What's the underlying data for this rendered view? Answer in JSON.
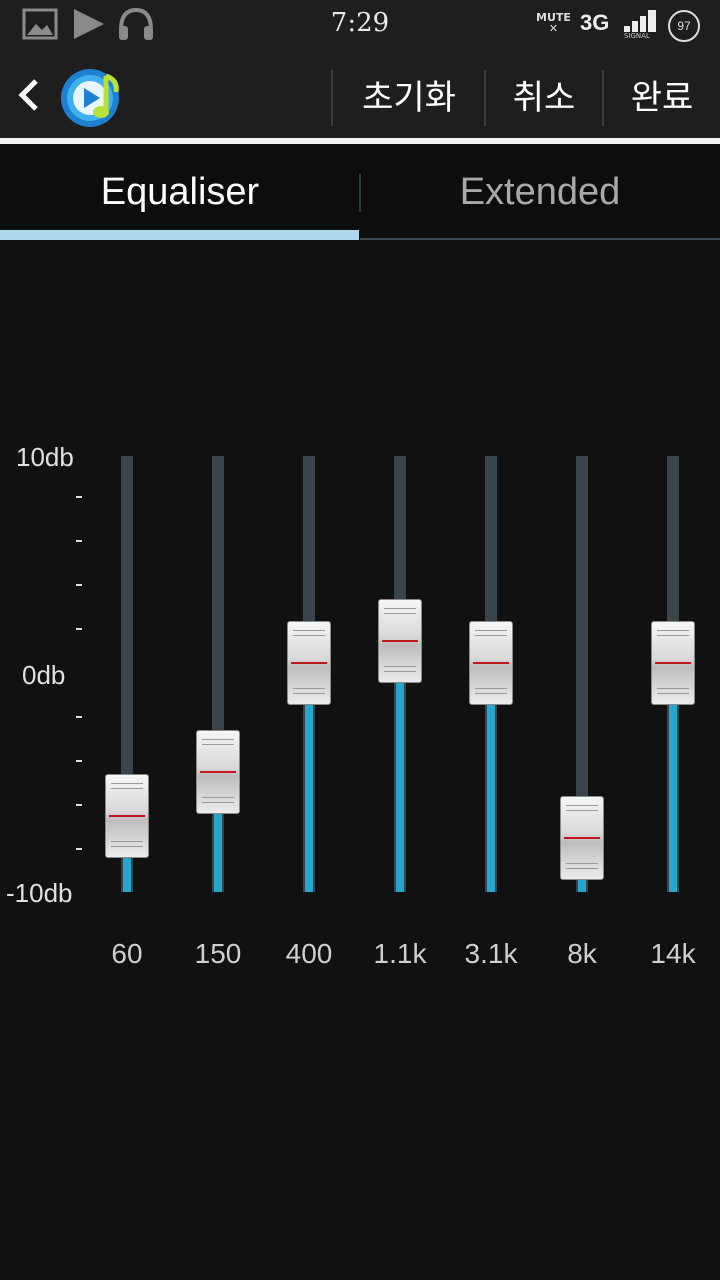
{
  "status_bar": {
    "time": "7:29",
    "icons": [
      "gallery-icon",
      "play-icon",
      "headphones-icon"
    ],
    "mute_label": "MUTE",
    "network": "3G",
    "signal_label": "SIGNAL",
    "battery": "97"
  },
  "action_bar": {
    "back_icon": "chevron-left-icon",
    "app_icon": "music-player-icon",
    "reset_label": "초기화",
    "cancel_label": "취소",
    "done_label": "완료"
  },
  "tabs": {
    "active": "Equaliser",
    "inactive": "Extended"
  },
  "equalizer": {
    "max_label": "10db",
    "mid_label": "0db",
    "min_label": "-10db",
    "range_db": [
      -10,
      10
    ],
    "accent_color": "#26a6cc",
    "bands": [
      {
        "freq": "60",
        "db": -6.5
      },
      {
        "freq": "150",
        "db": -4.5
      },
      {
        "freq": "400",
        "db": 0.5
      },
      {
        "freq": "1.1k",
        "db": 1.5
      },
      {
        "freq": "3.1k",
        "db": 0.5
      },
      {
        "freq": "8k",
        "db": -7.5
      },
      {
        "freq": "14k",
        "db": 0.5
      }
    ]
  }
}
